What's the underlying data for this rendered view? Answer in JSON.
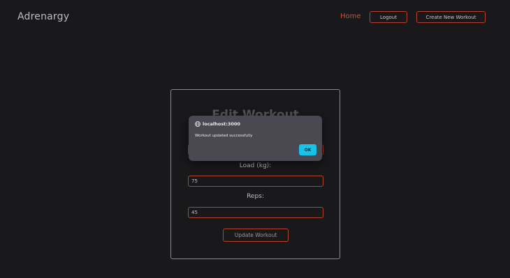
{
  "header": {
    "brand": "Adrenargy",
    "nav_home": "Home",
    "logout_label": "Logout",
    "create_label": "Create New Workout"
  },
  "form": {
    "title": "Edit Workout",
    "load_label": "Load (kg):",
    "load_value": "75",
    "reps_label": "Reps:",
    "reps_value": "45",
    "submit_label": "Update Workout"
  },
  "dialog": {
    "origin": "localhost:3000",
    "message": "Workout updated successfully",
    "ok_label": "OK",
    "icon": "globe-icon"
  },
  "colors": {
    "background": "#19181b",
    "accent": "#d2512f",
    "dialog_bg": "#4a4850",
    "ok_button": "#16c4ea"
  }
}
